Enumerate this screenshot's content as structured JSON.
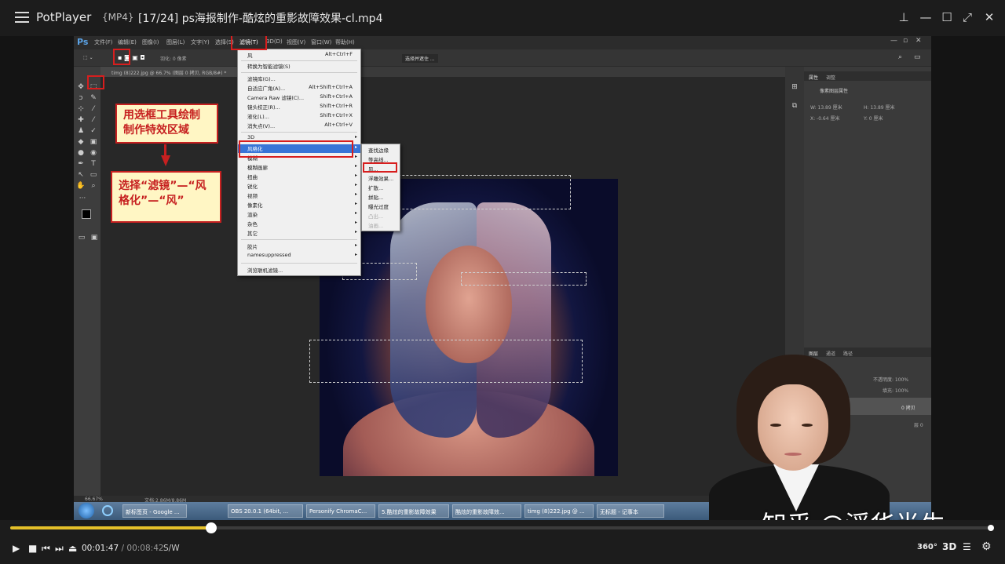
{
  "player": {
    "app_name": "PotPlayer",
    "format": "{MP4}",
    "title": "[17/24] ps海报制作-酷炫的重影故障效果-cl.mp4",
    "accent": "#e6c12a"
  },
  "photoshop": {
    "logo": "Ps",
    "menus": [
      "文件(F)",
      "编辑(E)",
      "图像(I)",
      "图层(L)",
      "文字(Y)",
      "选择(S)",
      "滤镜(T)",
      "3D(D)",
      "视图(V)",
      "窗口(W)",
      "帮助(H)"
    ],
    "options_feather": "羽化: 0 像素",
    "options_button": "选择并遮住 ...",
    "doc_tab": "timg (8)222.jpg @ 66.7% (图层 0 拷贝, RGB/8#) *",
    "status_zoom": "66.67%",
    "status_doc": "文档:2.86M/8.86M",
    "properties_tabs": [
      "属性",
      "调整"
    ],
    "properties_title": "像素图层属性",
    "prop_w": "W: 13.89 厘米",
    "prop_h": "H: 13.89 厘米",
    "prop_x": "X: -0.64 厘米",
    "prop_y": "Y: 0 厘米",
    "layers_tabs": [
      "图层",
      "通道",
      "路径"
    ],
    "layers_opacity": "不透明度: 100%",
    "layers_fill": "填充: 100%",
    "layer_copy": "0 拷贝",
    "layer_0": "层 0"
  },
  "filter_menu": {
    "items": [
      {
        "label": "风",
        "shortcut": "Alt+Ctrl+F"
      },
      {
        "label": "转换为智能滤镜(S)",
        "shortcut": ""
      },
      {
        "label": "滤镜库(G)...",
        "shortcut": ""
      },
      {
        "label": "自适应广角(A)...",
        "shortcut": "Alt+Shift+Ctrl+A"
      },
      {
        "label": "Camera Raw 滤镜(C)...",
        "shortcut": "Shift+Ctrl+A"
      },
      {
        "label": "镜头校正(R)...",
        "shortcut": "Shift+Ctrl+R"
      },
      {
        "label": "液化(L)...",
        "shortcut": "Shift+Ctrl+X"
      },
      {
        "label": "消失点(V)...",
        "shortcut": "Alt+Ctrl+V"
      },
      {
        "label": "3D",
        "shortcut": ""
      },
      {
        "label": "风格化",
        "shortcut": ""
      },
      {
        "label": "模糊",
        "shortcut": ""
      },
      {
        "label": "模糊画廊",
        "shortcut": ""
      },
      {
        "label": "扭曲",
        "shortcut": ""
      },
      {
        "label": "锐化",
        "shortcut": ""
      },
      {
        "label": "视频",
        "shortcut": ""
      },
      {
        "label": "像素化",
        "shortcut": ""
      },
      {
        "label": "渲染",
        "shortcut": ""
      },
      {
        "label": "杂色",
        "shortcut": ""
      },
      {
        "label": "其它",
        "shortcut": ""
      },
      {
        "label": "胶片",
        "shortcut": ""
      },
      {
        "label": "namesuppressed",
        "shortcut": ""
      },
      {
        "label": "浏览联机滤镜...",
        "shortcut": ""
      }
    ],
    "submenu": [
      "查找边缘",
      "等高线...",
      "风...",
      "浮雕效果...",
      "扩散...",
      "拼贴...",
      "曝光过度",
      "凸出...",
      "油画..."
    ]
  },
  "annotations": {
    "box1": "用选框工具绘制制作特效区域",
    "box1_line1": "用选框工具绘制",
    "box1_line2": "制作特效区域",
    "box2_line1": "选择“滤镜”—“风",
    "box2_line2": "格化”—“风”"
  },
  "taskbar": {
    "items": [
      "新标签页 - Google ...",
      "OBS 20.0.1 (64bit, ...",
      "Personify ChromaC...",
      "5.酷炫的重影故障效果",
      "酷炫的重影故障效...",
      "timg (8)222.jpg @ ...",
      "无标题 - 记事本"
    ]
  },
  "watermark": "知乎 @浮华半生",
  "playback": {
    "current_time": "00:01:47",
    "total_time": "00:08:42",
    "separator": "/",
    "progress": 0.205,
    "sw_label": "S/W",
    "badge_360": "360°",
    "badge_3d": "3D"
  }
}
